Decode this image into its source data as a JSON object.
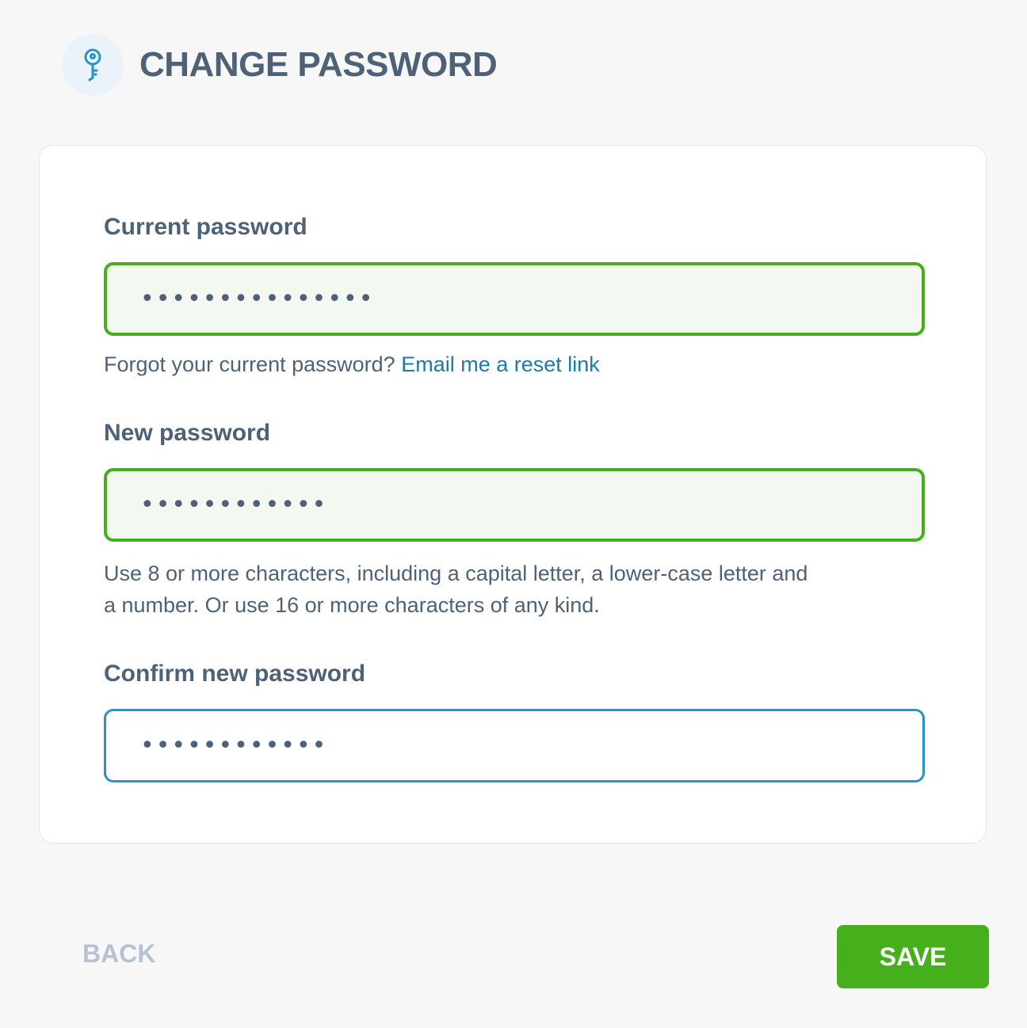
{
  "header": {
    "title": "CHANGE PASSWORD",
    "icon": "key-icon",
    "icon_color": "#2993c9"
  },
  "form": {
    "current_password": {
      "label": "Current password",
      "value": "•••••••••••••••",
      "state": "valid"
    },
    "forgot": {
      "text": "Forgot your current password?",
      "link": "Email me a reset link"
    },
    "new_password": {
      "label": "New password",
      "value": "••••••••••••",
      "state": "valid",
      "hint_line1": "Use 8 or more characters, including a capital letter, a lower-case letter and",
      "hint_line2": "a number. Or use 16 or more characters of any kind."
    },
    "confirm_password": {
      "label": "Confirm new password",
      "value": "••••••••••••",
      "state": "focused"
    }
  },
  "footer": {
    "back_label": "BACK",
    "save_label": "SAVE"
  },
  "colors": {
    "valid_border": "#45b01c",
    "valid_bg": "#f3f9f1",
    "focus_border": "#2993c9",
    "save_bg": "#45b01c",
    "link": "#1d7aa5",
    "back_disabled": "#b4c3d2"
  }
}
